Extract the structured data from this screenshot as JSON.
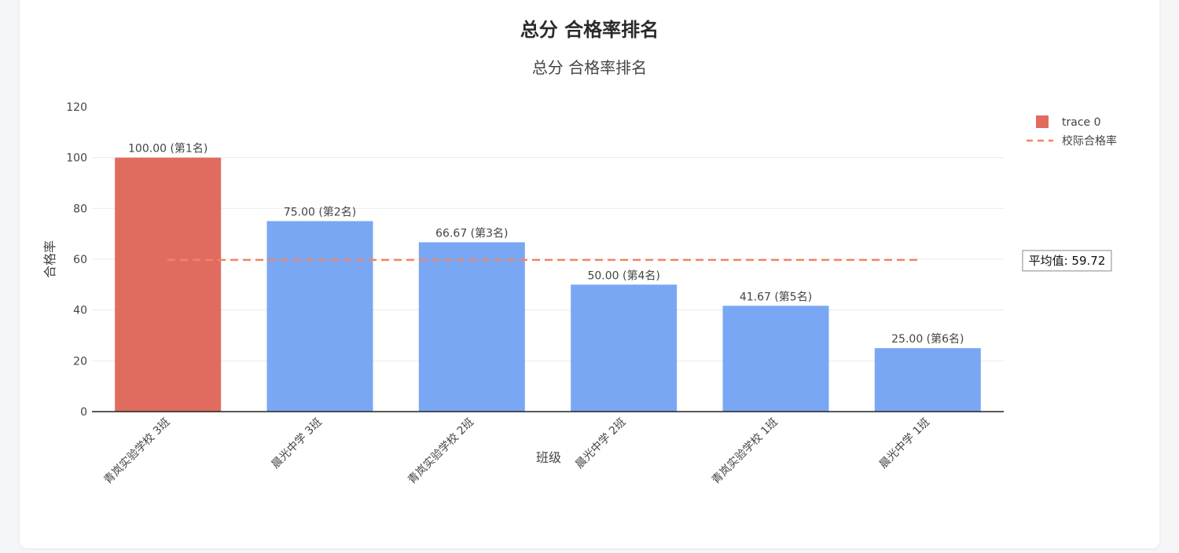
{
  "page": {
    "title": "总分 合格率排名"
  },
  "chart_data": {
    "type": "bar",
    "title": "总分 合格率排名",
    "xlabel": "班级",
    "ylabel": "合格率",
    "ylim": [
      0,
      120
    ],
    "yticks": [
      0,
      20,
      40,
      60,
      80,
      100,
      120
    ],
    "categories": [
      "青岚实验学校 3班",
      "晨光中学 3班",
      "青岚实验学校 2班",
      "晨光中学 2班",
      "青岚实验学校 1班",
      "晨光中学 1班"
    ],
    "series": [
      {
        "name": "trace 0",
        "values": [
          100.0,
          75.0,
          66.67,
          50.0,
          41.67,
          25.0
        ],
        "data_labels": [
          "100.00 (第1名)",
          "75.00 (第2名)",
          "66.67 (第3名)",
          "50.00 (第4名)",
          "41.67 (第5名)",
          "25.00 (第6名)"
        ],
        "colors": [
          "#e06c5f",
          "#7aa7f4",
          "#7aa7f4",
          "#7aa7f4",
          "#7aa7f4",
          "#7aa7f4"
        ]
      }
    ],
    "reference_line": {
      "name": "校际合格率",
      "value": 59.72,
      "color": "#f08466",
      "annotation": "平均值: 59.72"
    },
    "legend": {
      "placement": "top-right",
      "entries": [
        "trace 0",
        "校际合格率"
      ]
    },
    "grid": true
  }
}
